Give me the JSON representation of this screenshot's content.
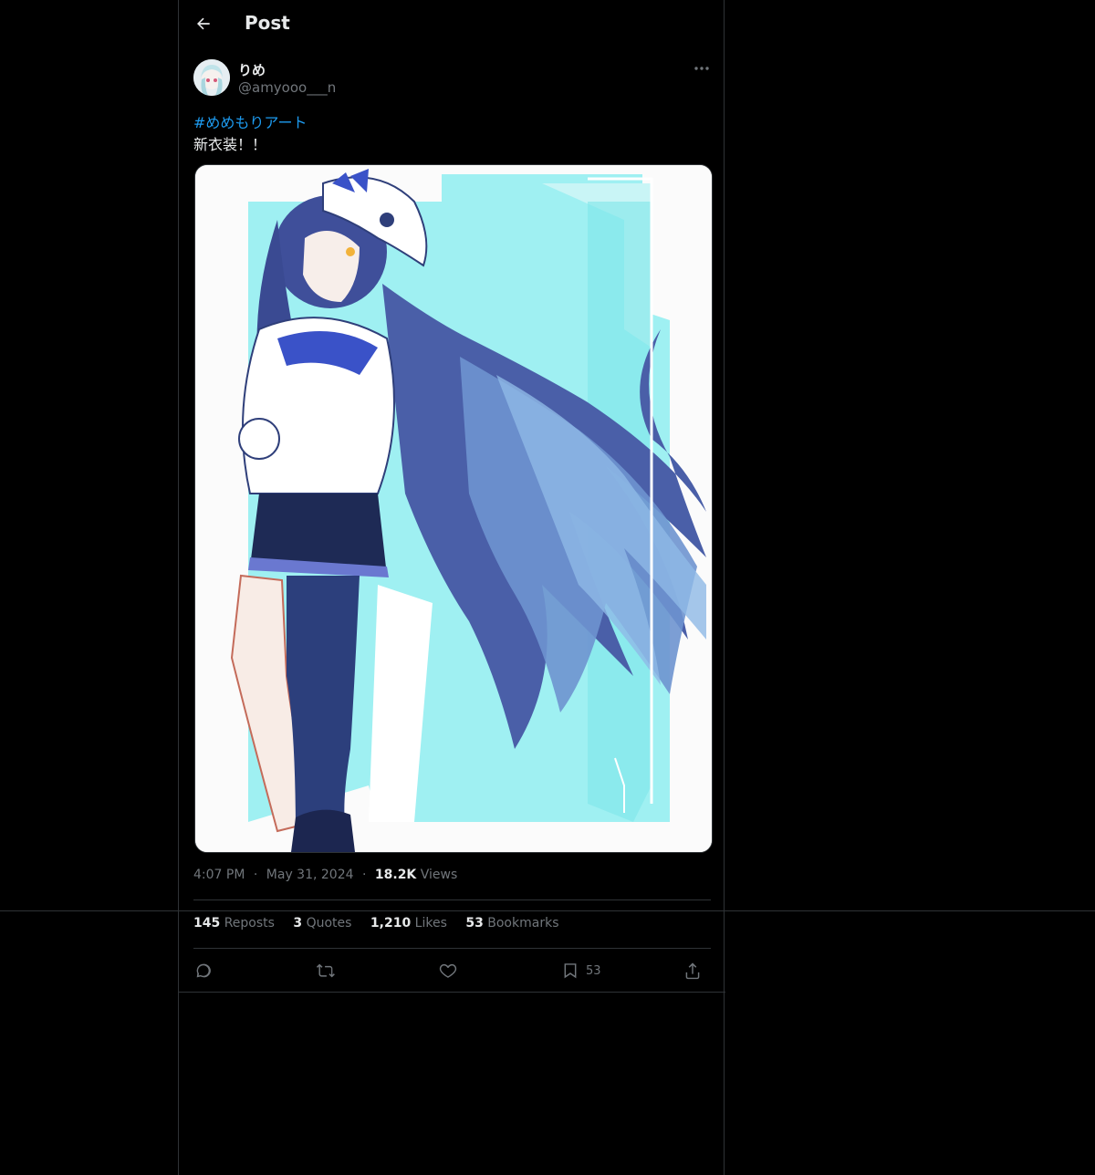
{
  "header": {
    "title": "Post",
    "back_icon": "arrow-left-icon"
  },
  "author": {
    "name": "りめ",
    "handle": "@amyooo___n",
    "avatar_icon": "avatar-image"
  },
  "post": {
    "hashtag": "#めめもりアート",
    "text": "新衣装！！",
    "media_alt": "illustration"
  },
  "meta": {
    "time": "4:07 PM",
    "sep1": "·",
    "date": "May 31, 2024",
    "sep2": "·",
    "views_count": "18.2K",
    "views_label": "Views"
  },
  "stats": {
    "reposts_count": "145",
    "reposts_label": "Reposts",
    "quotes_count": "3",
    "quotes_label": "Quotes",
    "likes_count": "1,210",
    "likes_label": "Likes",
    "bookmarks_count": "53",
    "bookmarks_label": "Bookmarks"
  },
  "actions": {
    "reply_icon": "reply-icon",
    "repost_icon": "repost-icon",
    "like_icon": "heart-icon",
    "bookmark_icon": "bookmark-icon",
    "bookmark_count": "53",
    "share_icon": "share-icon"
  },
  "colors": {
    "background": "#000000",
    "border": "#2f3336",
    "accent": "#1d9bf0",
    "muted": "#71767b",
    "text": "#e7e9ea"
  }
}
